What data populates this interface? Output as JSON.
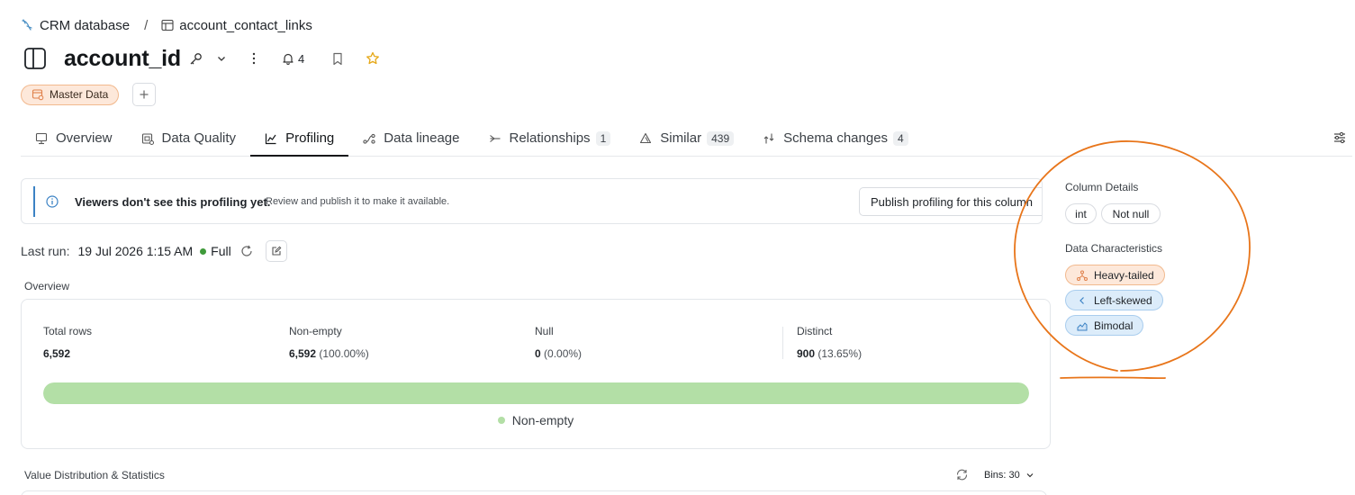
{
  "breadcrumb": {
    "database": "CRM database",
    "separator": "/",
    "table": "account_contact_links"
  },
  "header": {
    "title": "account_id",
    "notification_count": "4"
  },
  "tags": {
    "master": "Master Data"
  },
  "tabs": [
    {
      "label": "Overview",
      "count": ""
    },
    {
      "label": "Data Quality",
      "count": ""
    },
    {
      "label": "Profiling",
      "count": ""
    },
    {
      "label": "Data lineage",
      "count": ""
    },
    {
      "label": "Relationships",
      "count": "1"
    },
    {
      "label": "Similar",
      "count": "439"
    },
    {
      "label": "Schema changes",
      "count": "4"
    }
  ],
  "active_tab": "Profiling",
  "banner": {
    "title": "Viewers don't see this profiling yet.",
    "subtitle": "Review and publish it to make it available.",
    "button": "Publish profiling for this column"
  },
  "last_run": {
    "label": "Last run:",
    "value": "19 Jul 2026 1:15 AM",
    "mode": "Full"
  },
  "overview": {
    "section_label": "Overview",
    "stats": [
      {
        "label": "Total rows",
        "value": "6,592",
        "pct": ""
      },
      {
        "label": "Non-empty",
        "value": "6,592",
        "pct": "(100.00%)"
      },
      {
        "label": "Null",
        "value": "0",
        "pct": "(0.00%)"
      },
      {
        "label": "Distinct",
        "value": "900",
        "pct": "(13.65%)"
      }
    ],
    "non_empty_fraction": 1.0,
    "legend": "Non-empty",
    "fill_color": "#b3dfa6"
  },
  "value_distribution": {
    "label": "Value Distribution & Statistics",
    "bins": "Bins: 30"
  },
  "column_details": {
    "label": "Column Details",
    "type": "int",
    "nullability": "Not null"
  },
  "data_characteristics": {
    "label": "Data Characteristics",
    "items": [
      {
        "label": "Heavy-tailed",
        "icon": "branch-icon",
        "tone": "orange"
      },
      {
        "label": "Left-skewed",
        "icon": "chevron-left-icon",
        "tone": "blue"
      },
      {
        "label": "Bimodal",
        "icon": "area-chart-icon",
        "tone": "blue"
      }
    ]
  },
  "colors": {
    "accent_blue": "#3b82c4",
    "annotation_orange": "#e8751a",
    "status_green": "#3f9a3a"
  }
}
